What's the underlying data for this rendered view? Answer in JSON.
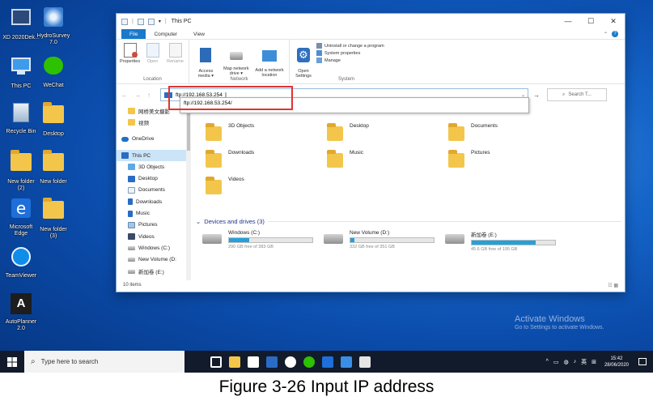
{
  "desktop": {
    "icons": [
      {
        "label": "XD 2020Dek...",
        "icon": "app-icon"
      },
      {
        "label": "HydroSurvey\n7.0",
        "icon": "app-icon"
      },
      {
        "label": "This PC",
        "icon": "computer-icon"
      },
      {
        "label": "WeChat",
        "icon": "wechat-icon"
      },
      {
        "label": "Recycle Bin",
        "icon": "recycle-bin-icon"
      },
      {
        "label": "Desktop",
        "icon": "folder-icon"
      },
      {
        "label": "New folder\n(2)",
        "icon": "folder-icon"
      },
      {
        "label": "New folder",
        "icon": "folder-icon"
      },
      {
        "label": "Microsoft\nEdge",
        "icon": "edge-icon"
      },
      {
        "label": "New folder\n(3)",
        "icon": "folder-icon"
      },
      {
        "label": "TeamViewer",
        "icon": "teamviewer-icon"
      },
      {
        "label": "AutoPlanner\n2.0",
        "icon": "app-icon"
      }
    ],
    "watermark_title": "Activate Windows",
    "watermark_sub": "Go to Settings to activate Windows."
  },
  "explorer": {
    "title": "This PC",
    "tabs": [
      "File",
      "Computer",
      "View"
    ],
    "ribbon": {
      "location": {
        "name": "Location",
        "buttons": [
          "Properties",
          "Open",
          "Rename"
        ]
      },
      "network": {
        "name": "Network",
        "buttons": [
          "Access\nmedia ▾",
          "Map network\ndrive ▾",
          "Add a network\nlocation"
        ]
      },
      "system": {
        "name": "System",
        "open_settings": "Open\nSettings",
        "items": [
          "Uninstall or change a program",
          "System properties",
          "Manage"
        ]
      }
    },
    "address": {
      "value": "ftp://192.168.53.254",
      "suggestion": "ftp://192.168.53.254/"
    },
    "search_placeholder": "Search T...",
    "nav": [
      {
        "label": "网桥美文摄影",
        "icon": "folder-icon",
        "selected": false
      },
      {
        "label": "视频",
        "icon": "folder-icon",
        "selected": false
      },
      {
        "label": "OneDrive",
        "icon": "cloud-icon",
        "selected": false
      },
      {
        "label": "This PC",
        "icon": "computer-icon",
        "selected": true
      },
      {
        "label": "3D Objects",
        "icon": "cube-icon",
        "selected": false
      },
      {
        "label": "Desktop",
        "icon": "desktop-icon",
        "selected": false
      },
      {
        "label": "Documents",
        "icon": "documents-icon",
        "selected": false
      },
      {
        "label": "Downloads",
        "icon": "download-icon",
        "selected": false
      },
      {
        "label": "Music",
        "icon": "music-icon",
        "selected": false
      },
      {
        "label": "Pictures",
        "icon": "pictures-icon",
        "selected": false
      },
      {
        "label": "Videos",
        "icon": "videos-icon",
        "selected": false
      },
      {
        "label": "Windows (C:)",
        "icon": "drive-icon",
        "selected": false
      },
      {
        "label": "New Volume (D:",
        "icon": "drive-icon",
        "selected": false
      },
      {
        "label": "新加卷 (E:)",
        "icon": "drive-icon",
        "selected": false
      }
    ],
    "folders": [
      {
        "label": "3D Objects",
        "icon": "cube-folder-icon"
      },
      {
        "label": "Desktop",
        "icon": "desktop-folder-icon"
      },
      {
        "label": "Documents",
        "icon": "documents-folder-icon"
      },
      {
        "label": "Downloads",
        "icon": "downloads-folder-icon"
      },
      {
        "label": "Music",
        "icon": "music-folder-icon"
      },
      {
        "label": "Pictures",
        "icon": "pictures-folder-icon"
      },
      {
        "label": "Videos",
        "icon": "videos-folder-icon"
      }
    ],
    "devices_header": "Devices and drives (3)",
    "drives": [
      {
        "label": "Windows (C:)",
        "free": "290 GB free of 383 GB",
        "used_fraction": 0.24,
        "icon": "windows-drive-icon"
      },
      {
        "label": "New Volume (D:)",
        "free": "332 GB free of 351 GB",
        "used_fraction": 0.05,
        "icon": "drive-icon"
      },
      {
        "label": "新加卷 (E:)",
        "free": "45.6 GB free of 195 GB",
        "used_fraction": 0.77,
        "icon": "drive-icon"
      }
    ],
    "status": "10 items"
  },
  "taskbar": {
    "search_placeholder": "Type here to search",
    "tray_lang": "英",
    "time": "15:42",
    "date": "28/06/2020"
  },
  "caption": "Figure 3-26 Input IP address",
  "colors": {
    "accent": "#1979ca",
    "highlight": "#e0342f",
    "drive_bar": "#26a0da"
  }
}
